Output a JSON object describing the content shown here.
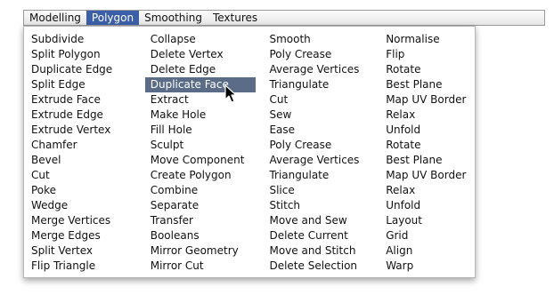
{
  "menubar": {
    "items": [
      {
        "label": "Modelling",
        "active": false
      },
      {
        "label": "Polygon",
        "active": true
      },
      {
        "label": "Smoothing",
        "active": false
      },
      {
        "label": "Textures",
        "active": false
      }
    ]
  },
  "menu": {
    "selected": "Duplicate Face",
    "columns": [
      [
        "Subdivide",
        "Split Polygon",
        "Duplicate Edge",
        "Split Edge",
        "Extrude Face",
        "Extrude Edge",
        "Extrude Vertex",
        "Chamfer",
        "Bevel",
        "Cut",
        "Poke",
        "Wedge",
        "Merge Vertices",
        "Merge Edges",
        "Split Vertex",
        "Flip Triangle"
      ],
      [
        "Collapse",
        "Delete Vertex",
        "Delete Edge",
        "Duplicate Face",
        "Extract",
        "Make Hole",
        "Fill Hole",
        "Sculpt",
        "Move Component",
        "Create Polygon",
        "Combine",
        "Separate",
        "Transfer",
        "Booleans",
        "Mirror Geometry",
        "Mirror Cut"
      ],
      [
        "Smooth",
        "Poly Crease",
        "Average Vertices",
        "Triangulate",
        "Cut",
        "Sew",
        "Ease",
        "Poly Crease",
        "Average Vertices",
        "Triangulate",
        "Slice",
        "Stitch",
        "Move and Sew",
        "Delete Current",
        "Move and Stitch",
        "Delete Selection"
      ],
      [
        "Normalise",
        "Flip",
        "Rotate",
        "Best Plane",
        "Map UV Border",
        "Relax",
        "Unfold",
        "Rotate",
        "Best Plane",
        "Map UV Border",
        "Relax",
        "Unfold",
        "Layout",
        "Grid",
        "Align",
        "Warp"
      ]
    ]
  },
  "cursor": {
    "icon": "arrow-cursor-icon"
  },
  "colors": {
    "active_tab": "#3b5fa8",
    "selected_item": "#5a6c88"
  }
}
